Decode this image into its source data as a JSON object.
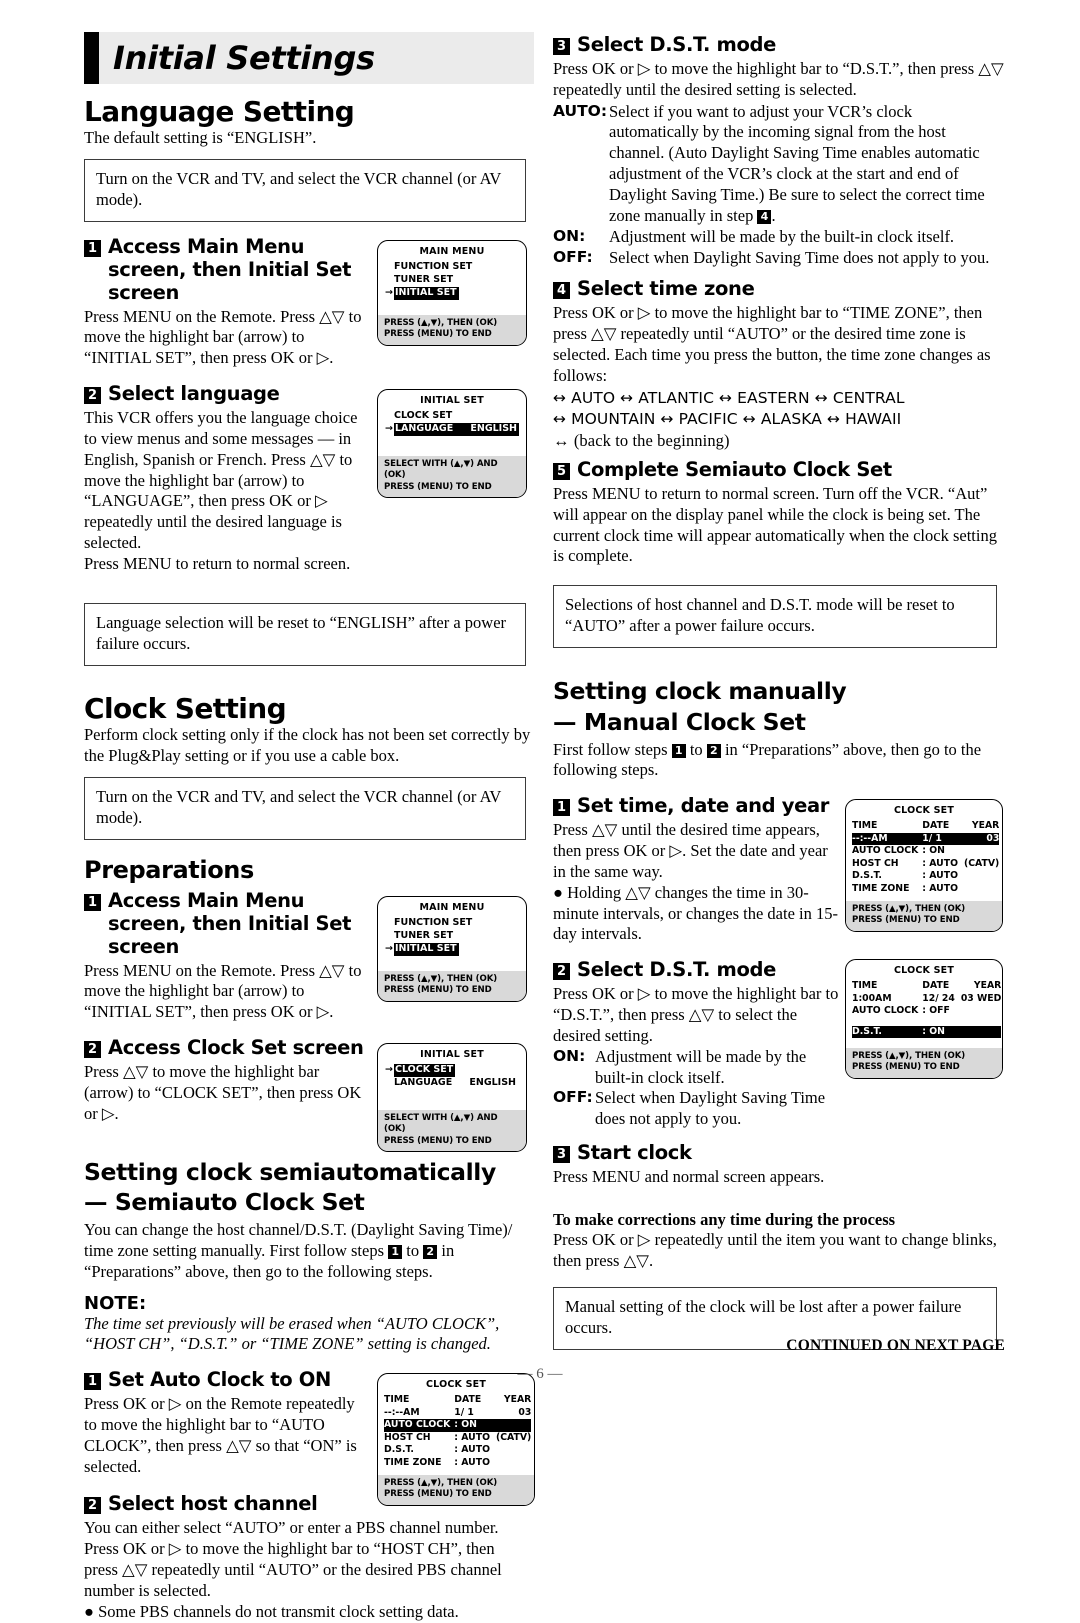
{
  "chapter": {
    "title": "Initial Settings"
  },
  "language_setting": {
    "heading": "Language Setting",
    "intro": "The default setting is “ENGLISH”.",
    "prep_box": "Turn on the VCR and TV, and select the VCR channel (or AV mode).",
    "step1": {
      "num": "1",
      "title": "Access Main Menu screen, then Initial Set screen",
      "body": "Press MENU on the Remote. Press △▽ to move the highlight bar (arrow) to “INITIAL SET”, then press OK or ▷."
    },
    "step2": {
      "num": "2",
      "title": "Select language",
      "body": "This VCR offers you the language choice to view menus and some messages — in English, Spanish or French. Press △▽ to move the highlight bar (arrow) to “LANGUAGE”, then press OK or ▷ repeatedly until the desired language is selected.",
      "body2": "Press MENU to return to normal screen."
    },
    "note_box": "Language selection will be reset to “ENGLISH” after a power failure occurs."
  },
  "clock_setting": {
    "heading": "Clock Setting",
    "intro": "Perform clock setting only if the clock has not been set correctly by the Plug&Play setting or if you use a cable box.",
    "prep_box": "Turn on the VCR and TV, and select the VCR channel (or AV mode).",
    "preparations_heading": "Preparations",
    "step1": {
      "num": "1",
      "title": "Access Main Menu screen, then Initial Set screen",
      "body": "Press MENU on the Remote. Press △▽ to move the highlight bar (arrow) to “INITIAL SET”, then press OK or ▷."
    },
    "step2": {
      "num": "2",
      "title": "Access Clock Set screen",
      "body": "Press △▽ to move the highlight bar (arrow) to “CLOCK SET”, then press OK or ▷."
    }
  },
  "semiauto": {
    "heading_line1": "Setting clock semiautomatically",
    "heading_line2": "— Semiauto Clock Set",
    "intro": "You can change the host channel/D.S.T. (Daylight Saving Time)/ time zone setting manually. First follow steps 1 to 2 in “Preparations” above, then go to the following steps.",
    "note_label": "NOTE:",
    "note_text": "The time set previously will be erased when “AUTO CLOCK”, “HOST CH”, “D.S.T.” or “TIME ZONE” setting is changed.",
    "step1": {
      "num": "1",
      "title": "Set Auto Clock to ON",
      "body": "Press OK or ▷ on the Remote repeatedly to move the highlight bar to “AUTO CLOCK”, then press △▽ so that “ON” is selected."
    },
    "step2": {
      "num": "2",
      "title": "Select host channel",
      "body": "You can either select “AUTO” or enter a PBS channel number. Press OK or ▷ to move the highlight bar to “HOST CH”, then press △▽ repeatedly until “AUTO” or the desired PBS channel number is selected.",
      "bullet": "Some PBS channels do not transmit clock setting data."
    },
    "step3": {
      "num": "3",
      "title": "Select D.S.T. mode",
      "body": "Press OK or ▷ to move the highlight bar to “D.S.T.”, then press △▽ repeatedly until the desired setting is selected.",
      "defs": [
        {
          "term": "AUTO:",
          "text": "Select if you want to adjust your VCR’s clock automatically by the incoming signal from the host channel. (Auto Daylight Saving Time enables automatic adjustment of the VCR’s clock at the start and end of Daylight Saving Time.) Be sure to select the correct time zone manually in step 4."
        },
        {
          "term": "ON:",
          "text": "Adjustment will be made by the built-in clock itself."
        },
        {
          "term": "OFF:",
          "text": "Select when Daylight Saving Time does not apply to you."
        }
      ]
    },
    "step4": {
      "num": "4",
      "title": "Select time zone",
      "body": "Press OK or ▷ to move the highlight bar to “TIME ZONE”, then press △▽ repeatedly until “AUTO” or the desired time zone is selected. Each time you press the button, the time zone changes as follows:",
      "zones_line1": "↔ AUTO ↔ ATLANTIC ↔ EASTERN ↔ CENTRAL",
      "zones_line2": "↔ MOUNTAIN ↔ PACIFIC ↔ ALASKA ↔ HAWAII",
      "zones_line3": "↔ (back to the beginning)"
    },
    "step5": {
      "num": "5",
      "title": "Complete Semiauto Clock Set",
      "body": "Press MENU to return to normal screen. Turn off the VCR. “Aut” will appear on the display panel while the clock is being set. The current clock time will appear automatically when the clock setting is complete."
    },
    "note_box": "Selections of host channel and D.S.T. mode will be reset to “AUTO” after a power failure occurs."
  },
  "manual": {
    "heading_line1": "Setting clock manually",
    "heading_line2": "— Manual Clock Set",
    "intro": "First follow steps 1 to 2 in “Preparations” above, then go to the following steps.",
    "step1": {
      "num": "1",
      "title": "Set time, date and year",
      "body": "Press △▽ until the desired time appears, then press OK or ▷. Set the date and year in the same way.",
      "bullet": "Holding △▽ changes the time in 30-minute intervals, or changes the date in 15-day intervals."
    },
    "step2": {
      "num": "2",
      "title": "Select D.S.T. mode",
      "body": "Press OK or ▷ to move the highlight bar to “D.S.T.”, then press △▽ to select the desired setting.",
      "defs": [
        {
          "term": "ON:",
          "text": "Adjustment will be made by the built-in clock itself."
        },
        {
          "term": "OFF:",
          "text": "Select when Daylight Saving Time does not apply to you."
        }
      ]
    },
    "step3": {
      "num": "3",
      "title": "Start clock",
      "body": "Press MENU and normal screen appears."
    },
    "corrections_heading": "To make corrections any time during the process",
    "corrections_body": "Press OK or ▷ repeatedly until the item you want to change blinks, then press △▽.",
    "note_box": "Manual setting of the clock will be lost after a power failure occurs."
  },
  "screens": {
    "main_menu_1": {
      "title": "MAIN MENU",
      "items": [
        "FUNCTION SET",
        "TUNER SET",
        "INITIAL SET"
      ],
      "highlighted": "INITIAL SET",
      "footer_line1": "PRESS (▲,▼), THEN (OK)",
      "footer_line2": "PRESS (MENU) TO END"
    },
    "initial_set_language": {
      "title": "INITIAL SET",
      "rows": [
        {
          "label": "CLOCK SET",
          "value": ""
        },
        {
          "label": "LANGUAGE",
          "value": "ENGLISH"
        }
      ],
      "highlighted": "LANGUAGE",
      "footer_line1": "SELECT WITH (▲,▼) AND (OK)",
      "footer_line2": "PRESS (MENU) TO END"
    },
    "main_menu_2": {
      "title": "MAIN MENU",
      "items": [
        "FUNCTION SET",
        "TUNER SET",
        "INITIAL SET"
      ],
      "highlighted": "INITIAL SET",
      "footer_line1": "PRESS (▲,▼), THEN (OK)",
      "footer_line2": "PRESS (MENU) TO END"
    },
    "initial_set_clock": {
      "title": "INITIAL SET",
      "rows": [
        {
          "label": "CLOCK SET",
          "value": ""
        },
        {
          "label": "LANGUAGE",
          "value": "ENGLISH"
        }
      ],
      "highlighted": "CLOCK SET",
      "footer_line1": "SELECT WITH (▲,▼) AND (OK)",
      "footer_line2": "PRESS (MENU) TO END"
    },
    "clock_set_auto": {
      "title": "CLOCK SET",
      "col_headers": [
        "TIME",
        "DATE",
        "YEAR"
      ],
      "time": "--:--AM",
      "date": "1/ 1",
      "year": "03",
      "weekday": "",
      "rows": [
        {
          "label": "AUTO CLOCK",
          "sep": ":",
          "value": "ON",
          "extra": ""
        },
        {
          "label": "HOST CH",
          "sep": ":",
          "value": "AUTO",
          "extra": "(CATV)"
        },
        {
          "label": "D.S.T.",
          "sep": ":",
          "value": "AUTO",
          "extra": ""
        },
        {
          "label": "TIME ZONE",
          "sep": ":",
          "value": "AUTO",
          "extra": ""
        }
      ],
      "highlighted": "AUTO CLOCK",
      "footer_line1": "PRESS (▲,▼), THEN (OK)",
      "footer_line2": "PRESS (MENU) TO END"
    },
    "clock_set_time": {
      "title": "CLOCK SET",
      "col_headers": [
        "TIME",
        "DATE",
        "YEAR"
      ],
      "time": "--:--AM",
      "date": "1/ 1",
      "year": "03",
      "weekday": "",
      "rows": [
        {
          "label": "AUTO CLOCK",
          "sep": ":",
          "value": "ON",
          "extra": ""
        },
        {
          "label": "HOST CH",
          "sep": ":",
          "value": "AUTO",
          "extra": "(CATV)"
        },
        {
          "label": "D.S.T.",
          "sep": ":",
          "value": "AUTO",
          "extra": ""
        },
        {
          "label": "TIME ZONE",
          "sep": ":",
          "value": "AUTO",
          "extra": ""
        }
      ],
      "highlighted": "TIME-ROW",
      "footer_line1": "PRESS (▲,▼), THEN (OK)",
      "footer_line2": "PRESS (MENU) TO END"
    },
    "clock_set_dst": {
      "title": "CLOCK SET",
      "col_headers": [
        "TIME",
        "DATE",
        "YEAR"
      ],
      "time": "1:00AM",
      "date": "12/ 24",
      "year": "03",
      "weekday": "WED",
      "rows": [
        {
          "label": "AUTO CLOCK",
          "sep": ":",
          "value": "OFF",
          "extra": ""
        },
        {
          "label": "D.S.T.",
          "sep": ":",
          "value": "ON",
          "extra": ""
        }
      ],
      "highlighted": "D.S.T.",
      "footer_line1": "PRESS (▲,▼), THEN (OK)",
      "footer_line2": "PRESS (MENU) TO END"
    }
  },
  "footer": {
    "page_number": "— 6 —",
    "continued": "CONTINUED ON NEXT PAGE"
  }
}
